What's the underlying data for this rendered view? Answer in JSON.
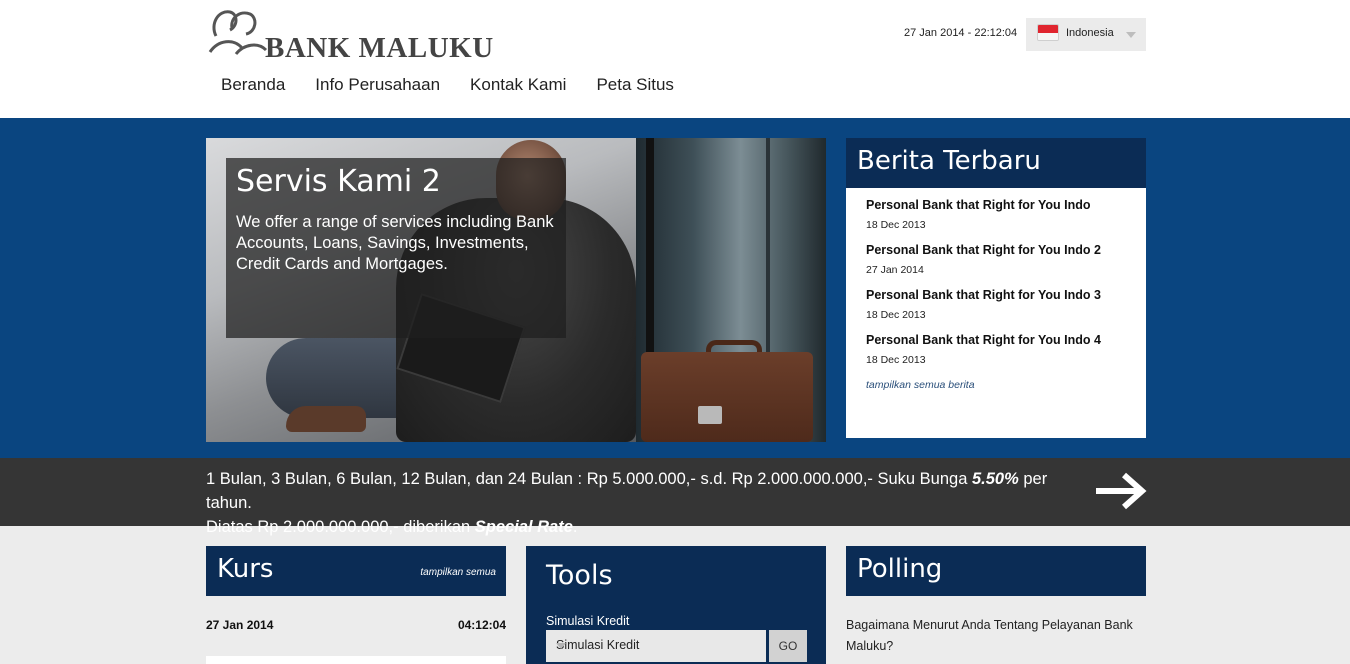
{
  "header": {
    "logo_text": "BANK MALUKU",
    "datetime": "27 Jan 2014 - 22:12:04",
    "language": "Indonesia"
  },
  "nav": {
    "items": [
      {
        "label": "Beranda"
      },
      {
        "label": "Info Perusahaan"
      },
      {
        "label": "Kontak Kami"
      },
      {
        "label": "Peta Situs"
      }
    ]
  },
  "slide": {
    "title": "Servis Kami 2",
    "text": "We offer a range of services including Bank Accounts, Loans, Savings, Investments, Credit Cards and Mortgages."
  },
  "news": {
    "title": "Berita Terbaru",
    "items": [
      {
        "title": "Personal Bank that Right for You Indo",
        "date": "18 Dec 2013"
      },
      {
        "title": "Personal Bank that Right for You Indo 2",
        "date": "27 Jan 2014"
      },
      {
        "title": "Personal Bank that Right for You Indo 3",
        "date": "18 Dec 2013"
      },
      {
        "title": "Personal Bank that Right for You Indo 4",
        "date": "18 Dec 2013"
      }
    ],
    "more_label": "tampilkan semua berita"
  },
  "ratebar": {
    "line1_pre": "1 Bulan, 3 Bulan, 6 Bulan, 12 Bulan, dan 24 Bulan : Rp 5.000.000,- s.d. Rp 2.000.000.000,- Suku Bunga ",
    "rate": "5.50%",
    "line1_post": " per tahun.",
    "line2_pre": "Diatas Rp 2.000.000.000,- diberikan ",
    "special": "Special Rate",
    "line2_post": "."
  },
  "kurs": {
    "title": "Kurs",
    "more_label": "tampilkan semua",
    "date": "27 Jan 2014",
    "time": "04:12:04"
  },
  "tools": {
    "title": "Tools",
    "label": "Simulasi Kredit",
    "selected": "Simulasi Kredit",
    "go_label": "GO"
  },
  "polling": {
    "title": "Polling",
    "question": "Bagaimana Menurut Anda Tentang Pelayanan Bank Maluku?"
  },
  "colors": {
    "hero_bg": "#0a4580",
    "panel_header": "#0b2c55",
    "ratebar_bg": "#353535",
    "page_bg": "#ececec"
  }
}
